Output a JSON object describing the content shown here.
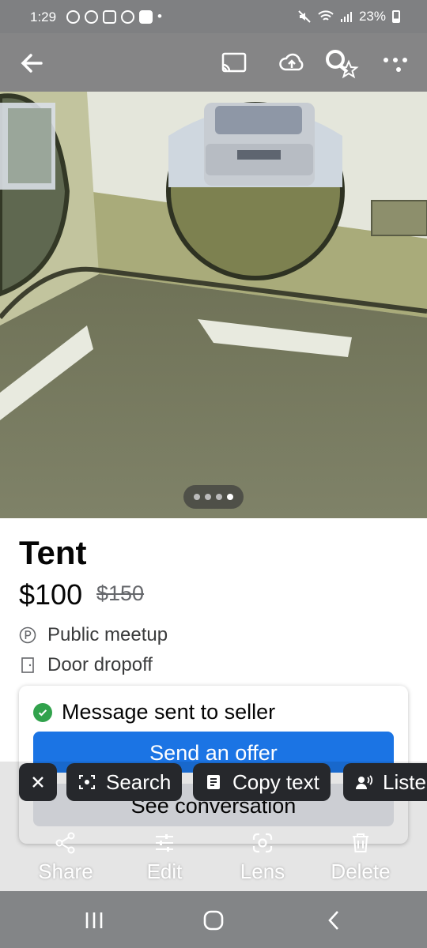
{
  "status_bar": {
    "time": "1:29",
    "battery": "23%"
  },
  "listing": {
    "title": "Tent",
    "price": "$100",
    "original_price": "$150",
    "delivery_options": [
      {
        "icon": "parking-icon",
        "label": "Public meetup"
      },
      {
        "icon": "door-icon",
        "label": "Door dropoff"
      }
    ],
    "photo_count": 4,
    "active_photo": 4
  },
  "seller_card": {
    "message": "Message sent to seller",
    "offer_button": "Send an offer",
    "conversation_button": "See conversation"
  },
  "lens_chips": {
    "search": "Search",
    "copy_text": "Copy text",
    "listen": "Liste"
  },
  "bottom_actions": {
    "share": "Share",
    "edit": "Edit",
    "lens": "Lens",
    "delete": "Delete"
  },
  "colors": {
    "accent": "#1b74e4",
    "success": "#31a24c"
  }
}
